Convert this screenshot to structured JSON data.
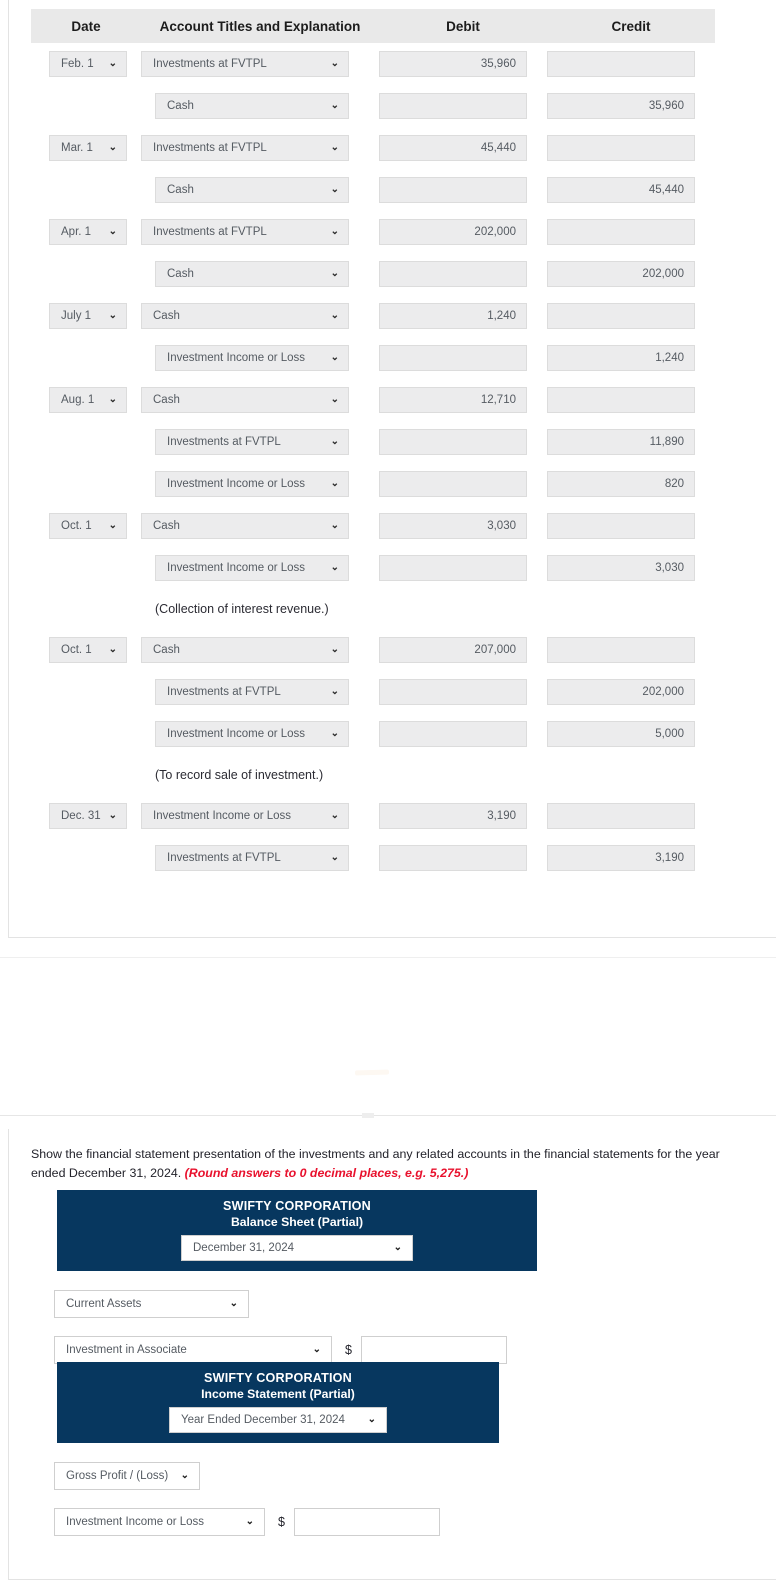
{
  "journal": {
    "columns": [
      "Date",
      "Account Titles and Explanation",
      "Debit",
      "Credit"
    ],
    "rows": [
      {
        "type": "entry",
        "date": "Feb. 1",
        "account": "Investments at FVTPL",
        "indent": false,
        "debit": "35,960",
        "credit": ""
      },
      {
        "type": "entry",
        "date": "",
        "account": "Cash",
        "indent": true,
        "debit": "",
        "credit": "35,960"
      },
      {
        "type": "entry",
        "date": "Mar. 1",
        "account": "Investments at FVTPL",
        "indent": false,
        "debit": "45,440",
        "credit": ""
      },
      {
        "type": "entry",
        "date": "",
        "account": "Cash",
        "indent": true,
        "debit": "",
        "credit": "45,440"
      },
      {
        "type": "entry",
        "date": "Apr. 1",
        "account": "Investments at FVTPL",
        "indent": false,
        "debit": "202,000",
        "credit": ""
      },
      {
        "type": "entry",
        "date": "",
        "account": "Cash",
        "indent": true,
        "debit": "",
        "credit": "202,000"
      },
      {
        "type": "entry",
        "date": "July 1",
        "account": "Cash",
        "indent": false,
        "debit": "1,240",
        "credit": ""
      },
      {
        "type": "entry",
        "date": "",
        "account": "Investment Income or Loss",
        "indent": true,
        "debit": "",
        "credit": "1,240"
      },
      {
        "type": "entry",
        "date": "Aug. 1",
        "account": "Cash",
        "indent": false,
        "debit": "12,710",
        "credit": ""
      },
      {
        "type": "entry",
        "date": "",
        "account": "Investments at FVTPL",
        "indent": true,
        "debit": "",
        "credit": "11,890"
      },
      {
        "type": "entry",
        "date": "",
        "account": "Investment Income or Loss",
        "indent": true,
        "debit": "",
        "credit": "820"
      },
      {
        "type": "entry",
        "date": "Oct. 1",
        "account": "Cash",
        "indent": false,
        "debit": "3,030",
        "credit": ""
      },
      {
        "type": "entry",
        "date": "",
        "account": "Investment Income or Loss",
        "indent": true,
        "debit": "",
        "credit": "3,030"
      },
      {
        "type": "note",
        "text": "(Collection of interest revenue.)"
      },
      {
        "type": "entry",
        "date": "Oct. 1",
        "account": "Cash",
        "indent": false,
        "debit": "207,000",
        "credit": ""
      },
      {
        "type": "entry",
        "date": "",
        "account": "Investments at FVTPL",
        "indent": true,
        "debit": "",
        "credit": "202,000"
      },
      {
        "type": "entry",
        "date": "",
        "account": "Investment Income or Loss",
        "indent": true,
        "debit": "",
        "credit": "5,000"
      },
      {
        "type": "note",
        "text": "(To record sale of investment.)"
      },
      {
        "type": "entry",
        "date": "Dec. 31",
        "account": "Investment Income or Loss",
        "indent": false,
        "debit": "3,190",
        "credit": ""
      },
      {
        "type": "entry",
        "date": "",
        "account": "Investments at FVTPL",
        "indent": true,
        "debit": "",
        "credit": "3,190"
      }
    ]
  },
  "statement_section": {
    "instruction_text": "Show the financial statement presentation of the investments and any related accounts in the financial statements for the year ended December 31, 2024. ",
    "instruction_emphasis": "(Round answers to 0 decimal places, e.g. 5,275.)",
    "balance_sheet": {
      "company": "SWIFTY CORPORATION",
      "statement_title": "Balance Sheet (Partial)",
      "period_select": "December 31, 2024",
      "section_select": "Current Assets",
      "line_item_select": "Investment in Associate",
      "currency_symbol": "$",
      "amount_value": ""
    },
    "income_statement": {
      "company": "SWIFTY CORPORATION",
      "statement_title": "Income Statement (Partial)",
      "period_select": "Year Ended December 31, 2024",
      "section_select": "Gross Profit / (Loss)",
      "line_item_select": "Investment Income or Loss",
      "currency_symbol": "$",
      "amount_value": ""
    }
  },
  "icons": {
    "chevron_down": "⌄"
  },
  "colors": {
    "banner_navy": "#07375f",
    "header_gray": "#e9e9e9",
    "field_gray": "#ececed",
    "emphasis_red": "#e8112d"
  }
}
